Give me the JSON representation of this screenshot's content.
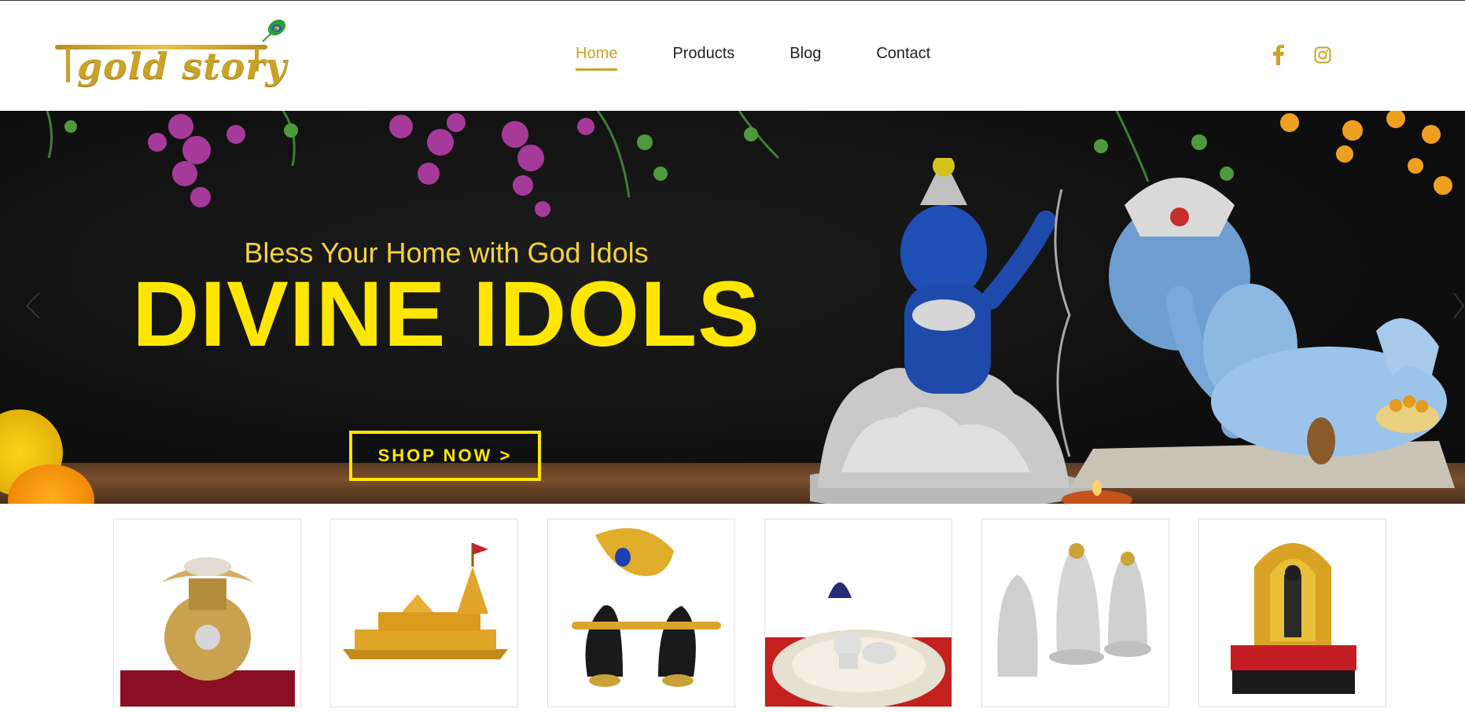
{
  "brand": {
    "logo_text": "gold story",
    "logo_icon": "peacock-feather-icon",
    "accent_color": "#c9a227"
  },
  "nav": {
    "items": [
      {
        "label": "Home",
        "active": true
      },
      {
        "label": "Products",
        "active": false
      },
      {
        "label": "Blog",
        "active": false
      },
      {
        "label": "Contact",
        "active": false
      }
    ]
  },
  "social": {
    "icons": [
      "facebook-icon",
      "instagram-icon"
    ]
  },
  "hero": {
    "subtitle": "Bless Your Home with God Idols",
    "title": "DIVINE IDOLS",
    "cta_label": "SHOP NOW >",
    "title_color": "#ffe600",
    "icons": [
      "chevron-left-icon",
      "chevron-right-icon"
    ]
  },
  "products": {
    "tiles": [
      {
        "name": "kalash-coin-pot"
      },
      {
        "name": "ram-mandir-model"
      },
      {
        "name": "peacock-feather-flute-hands"
      },
      {
        "name": "bal-gopal-thali"
      },
      {
        "name": "ram-darbar-silver-idols"
      },
      {
        "name": "ram-lalla-golden-idol"
      }
    ]
  }
}
